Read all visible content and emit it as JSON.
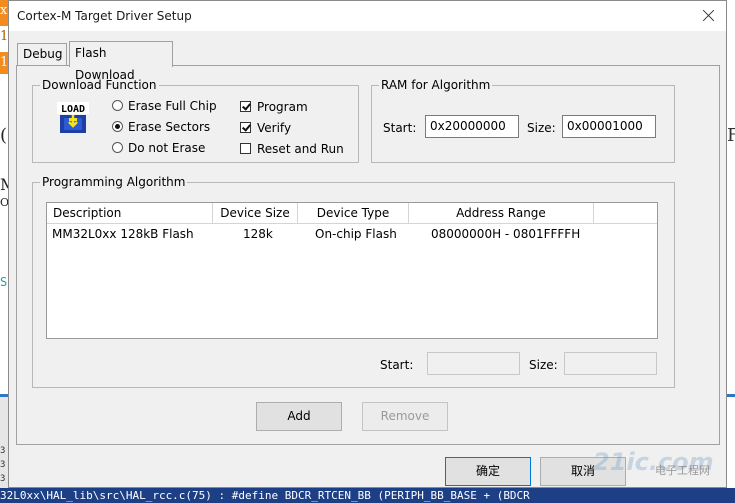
{
  "window": {
    "title": "Cortex-M Target Driver Setup"
  },
  "tabs": [
    {
      "label": "Debug",
      "active": false
    },
    {
      "label": "Flash Download",
      "active": true
    }
  ],
  "download_function": {
    "legend": "Download Function",
    "icon": "load-icon",
    "icon_text": "LOAD",
    "radios": [
      {
        "label": "Erase Full Chip",
        "checked": false
      },
      {
        "label": "Erase Sectors",
        "checked": true
      },
      {
        "label": "Do not Erase",
        "checked": false
      }
    ],
    "checks": [
      {
        "label": "Program",
        "checked": true
      },
      {
        "label": "Verify",
        "checked": true
      },
      {
        "label": "Reset and Run",
        "checked": false
      }
    ]
  },
  "ram": {
    "legend": "RAM for Algorithm",
    "start_label": "Start:",
    "start_value": "0x20000000",
    "size_label": "Size:",
    "size_value": "0x00001000"
  },
  "programming": {
    "legend": "Programming Algorithm",
    "columns": [
      "Description",
      "Device Size",
      "Device Type",
      "Address Range"
    ],
    "rows": [
      {
        "description": "MM32L0xx 128kB Flash",
        "device_size": "128k",
        "device_type": "On-chip Flash",
        "address_range": "08000000H - 0801FFFFH"
      }
    ],
    "start_label": "Start:",
    "start_value": "",
    "size_label": "Size:",
    "size_value": ""
  },
  "buttons": {
    "add": "Add",
    "remove": "Remove",
    "ok": "确定",
    "cancel": "取消"
  },
  "background": {
    "bottom_text": "32L0xx\\HAL_lib\\src\\HAL_rcc.c(75) : #define BDCR_RTCEN_BB                    (PERIPH_BB_BASE + (BDCR",
    "left_chars": [
      "x",
      "1",
      "1",
      "(",
      "M",
      "O",
      "S"
    ],
    "left_mini": [
      "3",
      "3",
      "3"
    ],
    "right_char": "F",
    "watermark": "21ic.com",
    "watermark_cn": "电子工程网"
  },
  "colors": {
    "accent": "#0078d7",
    "background_blue": "#1c3f86",
    "orange": "#f28c1e"
  }
}
